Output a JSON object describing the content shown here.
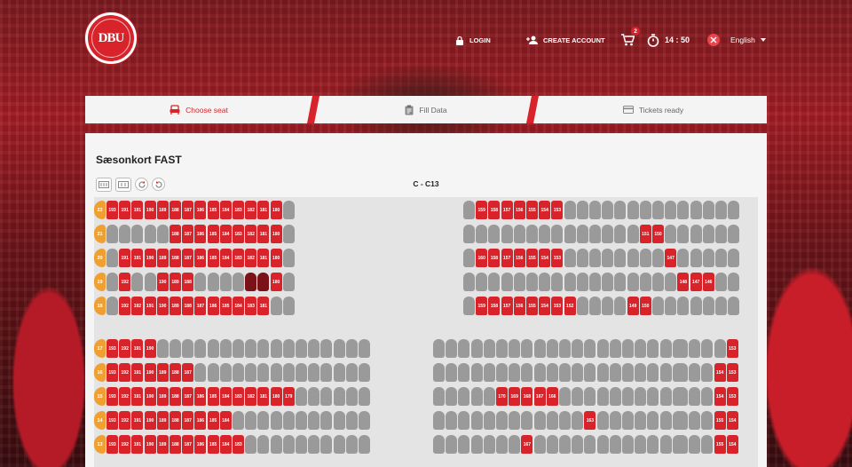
{
  "brand": {
    "logo_text": "DBU",
    "logo_ring_text": "DANSK BOLDSPIL UNION 1889"
  },
  "header": {
    "login_label": "LOGIN",
    "create_account_label": "CREATE ACCOUNT",
    "cart_count": "2",
    "timer": "14 : 50",
    "language": "English"
  },
  "steps": [
    {
      "label": "Choose seat",
      "icon": "armchair-icon",
      "active": true
    },
    {
      "label": "Fill Data",
      "icon": "clipboard-icon",
      "active": false
    },
    {
      "label": "Tickets ready",
      "icon": "ticket-card-icon",
      "active": false
    }
  ],
  "panel": {
    "title": "Sæsonkort FAST",
    "seat_label": "C - C13"
  },
  "colors": {
    "accent": "#d8232a",
    "available": "#d8232a",
    "taken": "#9a9a9a",
    "row_badge": "#f0a030"
  },
  "seatmap": {
    "upper_rows": [
      {
        "row": "22",
        "left": [
          "193",
          "191",
          "191",
          "190",
          "189",
          "188",
          "187",
          "186",
          "185",
          "184",
          "183",
          "182",
          "181",
          "180",
          "t"
        ],
        "right": [
          "t",
          "159",
          "158",
          "157",
          "156",
          "155",
          "154",
          "153",
          "t",
          "t",
          "t",
          "t",
          "t",
          "t",
          "t",
          "t",
          "t",
          "t",
          "t",
          "t",
          "t",
          "t"
        ]
      },
      {
        "row": "21",
        "left": [
          "t",
          "t",
          "t",
          "t",
          "t",
          "188",
          "187",
          "186",
          "185",
          "184",
          "183",
          "182",
          "181",
          "180",
          "t"
        ],
        "right": [
          "t",
          "t",
          "t",
          "t",
          "t",
          "t",
          "t",
          "t",
          "t",
          "t",
          "t",
          "t",
          "t",
          "t",
          "151",
          "150",
          "t",
          "t",
          "t",
          "t",
          "t",
          "t"
        ]
      },
      {
        "row": "20",
        "left": [
          "t",
          "191",
          "191",
          "190",
          "189",
          "188",
          "187",
          "186",
          "185",
          "184",
          "183",
          "182",
          "181",
          "180",
          "t"
        ],
        "right": [
          "t",
          "160",
          "158",
          "157",
          "156",
          "155",
          "154",
          "153",
          "t",
          "t",
          "t",
          "t",
          "t",
          "t",
          "t",
          "t",
          "147",
          "t",
          "t",
          "t",
          "t",
          "t"
        ]
      },
      {
        "row": "19",
        "left": [
          "t",
          "192",
          "t",
          "t",
          "190",
          "189",
          "188",
          "t",
          "t",
          "t",
          "t",
          "s",
          "s",
          "180",
          "t"
        ],
        "right": [
          "t",
          "t",
          "t",
          "t",
          "t",
          "t",
          "t",
          "t",
          "t",
          "t",
          "t",
          "t",
          "t",
          "t",
          "t",
          "t",
          "t",
          "148",
          "147",
          "146",
          "t",
          "t"
        ]
      },
      {
        "row": "18",
        "left": [
          "t",
          "192",
          "192",
          "191",
          "190",
          "189",
          "188",
          "187",
          "186",
          "185",
          "184",
          "183",
          "181",
          "t",
          "t"
        ],
        "right": [
          "t",
          "159",
          "158",
          "157",
          "156",
          "155",
          "154",
          "153",
          "152",
          "t",
          "t",
          "t",
          "t",
          "149",
          "150",
          "t",
          "t",
          "t",
          "t",
          "t",
          "t",
          "t"
        ]
      }
    ],
    "lower_rows": [
      {
        "row": "17",
        "a": [
          "193",
          "192",
          "191",
          "190",
          "t",
          "t",
          "t",
          "t",
          "t",
          "t",
          "t",
          "t",
          "t",
          "t",
          "t",
          "t",
          "t",
          "t",
          "t",
          "t",
          "t"
        ],
        "b": [
          "t",
          "t",
          "t",
          "t",
          "t",
          "t",
          "t",
          "t",
          "t",
          "t",
          "t",
          "t",
          "t",
          "t",
          "t",
          "t",
          "t",
          "t",
          "t",
          "t"
        ],
        "c": [
          "t",
          "t",
          "t",
          "t",
          "153"
        ]
      },
      {
        "row": "16",
        "a": [
          "193",
          "192",
          "191",
          "190",
          "189",
          "188",
          "187",
          "t",
          "t",
          "t",
          "t",
          "t",
          "t",
          "t",
          "t",
          "t",
          "t",
          "t",
          "t",
          "t",
          "t"
        ],
        "b": [
          "t",
          "t",
          "t",
          "t",
          "t",
          "t",
          "t",
          "t",
          "t",
          "t",
          "t",
          "t",
          "t",
          "t",
          "t",
          "t",
          "t",
          "t",
          "t",
          "t"
        ],
        "c": [
          "t",
          "t",
          "t",
          "154",
          "153"
        ]
      },
      {
        "row": "15",
        "a": [
          "193",
          "192",
          "191",
          "190",
          "189",
          "188",
          "187",
          "186",
          "185",
          "184",
          "183",
          "182",
          "181",
          "180",
          "179",
          "t",
          "t",
          "t",
          "t",
          "t",
          "t"
        ],
        "b": [
          "t",
          "t",
          "t",
          "t",
          "t",
          "170",
          "169",
          "168",
          "167",
          "166",
          "t",
          "t",
          "t",
          "t",
          "t",
          "t",
          "t",
          "t",
          "t",
          "t"
        ],
        "c": [
          "t",
          "t",
          "t",
          "154",
          "153"
        ]
      },
      {
        "row": "14",
        "a": [
          "193",
          "192",
          "191",
          "190",
          "189",
          "188",
          "187",
          "186",
          "185",
          "184",
          "t",
          "t",
          "t",
          "t",
          "t",
          "t",
          "t",
          "t",
          "t",
          "t",
          "t"
        ],
        "b": [
          "t",
          "t",
          "t",
          "t",
          "t",
          "t",
          "t",
          "t",
          "t",
          "t",
          "t",
          "t",
          "163",
          "t",
          "t",
          "t",
          "t",
          "t",
          "t",
          "t"
        ],
        "c": [
          "t",
          "t",
          "t",
          "155",
          "154"
        ]
      },
      {
        "row": "13",
        "a": [
          "193",
          "192",
          "191",
          "190",
          "189",
          "188",
          "187",
          "186",
          "185",
          "184",
          "183",
          "t",
          "t",
          "t",
          "t",
          "t",
          "t",
          "t",
          "t",
          "t",
          "t"
        ],
        "b": [
          "t",
          "t",
          "t",
          "t",
          "t",
          "t",
          "t",
          "167",
          "t",
          "t",
          "t",
          "t",
          "t",
          "t",
          "t",
          "t",
          "t",
          "t",
          "t",
          "t"
        ],
        "c": [
          "t",
          "t",
          "t",
          "155",
          "154"
        ]
      }
    ]
  }
}
